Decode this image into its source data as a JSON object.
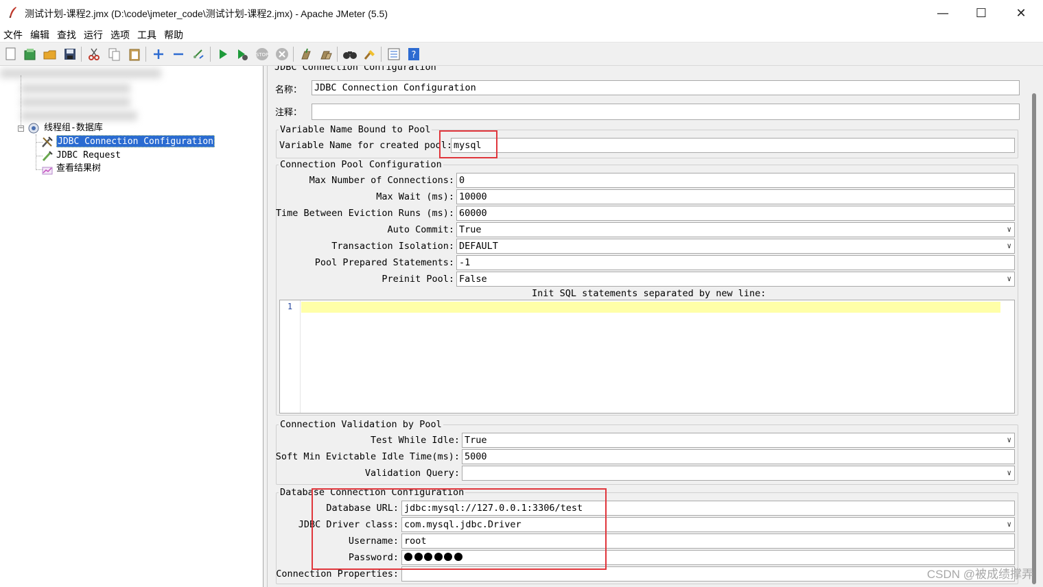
{
  "window": {
    "title": "测试计划-课程2.jmx (D:\\code\\jmeter_code\\测试计划-课程2.jmx) - Apache JMeter (5.5)",
    "controls": {
      "minimize": "—",
      "maximize": "☐",
      "close": "✕"
    }
  },
  "menu": [
    "文件",
    "编辑",
    "查找",
    "运行",
    "选项",
    "工具",
    "帮助"
  ],
  "toolbar": {
    "icons": [
      "new-icon",
      "templates-icon",
      "open-icon",
      "save-icon",
      "cut-icon",
      "copy-icon",
      "paste-icon",
      "expand-icon",
      "collapse-icon",
      "toggle-icon",
      "start-icon",
      "start-no-pause-icon",
      "stop-icon",
      "shutdown-icon",
      "clear-icon",
      "clear-all-icon",
      "search-icon",
      "reset-search-icon",
      "function-helper-icon",
      "help-icon"
    ]
  },
  "tree": {
    "thread_group": "线程组-数据库",
    "items": [
      {
        "label": "JDBC Connection Configuration",
        "icon": "wrench-icon",
        "selected": true
      },
      {
        "label": "JDBC Request",
        "icon": "pipette-icon",
        "selected": false
      },
      {
        "label": "查看结果树",
        "icon": "chart-icon",
        "selected": false
      }
    ]
  },
  "panel": {
    "header": "JDBC Connection Configuration",
    "name_label": "名称：",
    "name_value": "JDBC Connection Configuration",
    "comment_label": "注释：",
    "comment_value": "",
    "pool_var": {
      "title": "Variable Name Bound to Pool",
      "label": "Variable Name for created pool:",
      "value": "mysql"
    },
    "pool_config": {
      "title": "Connection Pool Configuration",
      "max_connections_label": "Max Number of Connections:",
      "max_connections": "0",
      "max_wait_label": "Max Wait (ms):",
      "max_wait": "10000",
      "eviction_label": "Time Between Eviction Runs (ms):",
      "eviction": "60000",
      "auto_commit_label": "Auto Commit:",
      "auto_commit": "True",
      "isolation_label": "Transaction Isolation:",
      "isolation": "DEFAULT",
      "prepared_label": "Pool Prepared Statements:",
      "prepared": "-1",
      "preinit_label": "Preinit Pool:",
      "preinit": "False",
      "init_sql_label": "Init SQL statements separated by new line:",
      "init_sql_line": "1"
    },
    "validation": {
      "title": "Connection Validation by Pool",
      "test_idle_label": "Test While Idle:",
      "test_idle": "True",
      "soft_min_label": "Soft Min Evictable Idle Time(ms):",
      "soft_min": "5000",
      "query_label": "Validation Query:",
      "query": ""
    },
    "database": {
      "title": "Database Connection Configuration",
      "url_label": "Database URL:",
      "url": "jdbc:mysql://127.0.0.1:3306/test",
      "driver_label": "JDBC Driver class:",
      "driver": "com.mysql.jdbc.Driver",
      "username_label": "Username:",
      "username": "root",
      "password_label": "Password:",
      "password_length": 6,
      "properties_label": "Connection Properties:"
    }
  },
  "watermark": "CSDN @被成绩撑弄"
}
